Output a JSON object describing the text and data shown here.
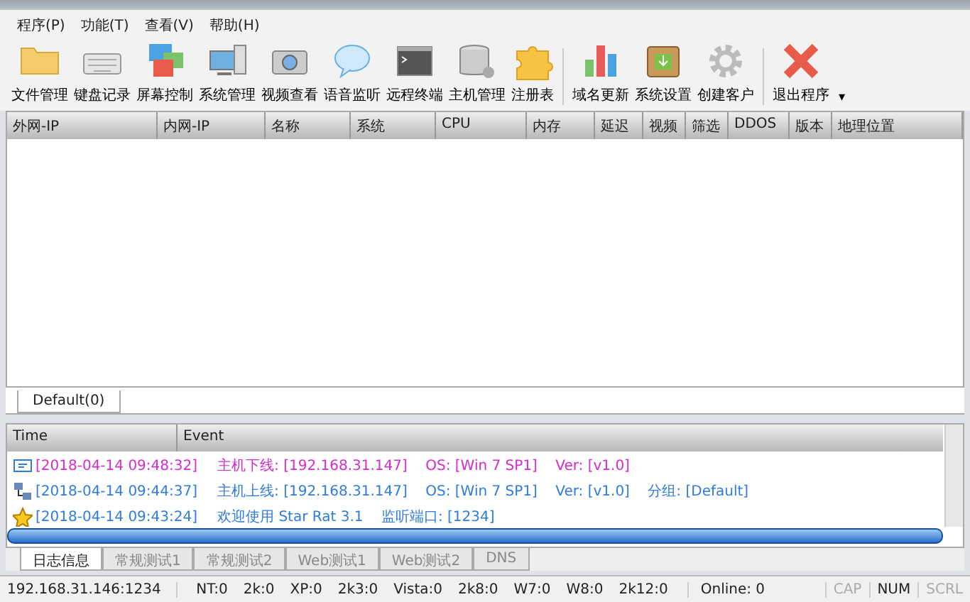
{
  "menu": [
    "程序(P)",
    "功能(T)",
    "查看(V)",
    "帮助(H)"
  ],
  "toolbar": [
    [
      {
        "label": "文件管理"
      },
      {
        "label": "键盘记录"
      },
      {
        "label": "屏幕控制"
      },
      {
        "label": "系统管理"
      },
      {
        "label": "视频查看"
      },
      {
        "label": "语音监听"
      },
      {
        "label": "远程终端"
      },
      {
        "label": "主机管理"
      },
      {
        "label": "注册表"
      }
    ],
    [
      {
        "label": "域名更新"
      },
      {
        "label": "系统设置"
      },
      {
        "label": "创建客户"
      }
    ],
    [
      {
        "label": "退出程序",
        "dropdown": "▾"
      }
    ]
  ],
  "host_table": {
    "columns": [
      "外网-IP",
      "内网-IP",
      "名称",
      "系统",
      "CPU",
      "内存",
      "延迟",
      "视频",
      "筛选",
      "DDOS",
      "版本",
      "地理位置"
    ]
  },
  "group_tabs": [
    {
      "label": "Default(0)",
      "selected": true
    }
  ],
  "log": {
    "columns": [
      "Time",
      "Event"
    ],
    "rows": [
      {
        "time": "[2018-04-14 09:48:32]",
        "event": "主机下线: [192.168.31.147]    OS: [Win 7 SP1]    Ver: [v1.0]",
        "color": "#d62ad0"
      },
      {
        "time": "[2018-04-14 09:44:37]",
        "event": "主机上线: [192.168.31.147]    OS: [Win 7 SP1]    Ver: [v1.0]    分组: [Default]",
        "color": "#2f7ce0"
      },
      {
        "time": "[2018-04-14 09:43:24]",
        "event": "欢迎使用 Star Rat 3.1    监听端口: [1234]",
        "color": "#2f7ce0"
      }
    ]
  },
  "log_tabs": [
    {
      "label": "日志信息",
      "selected": true
    },
    {
      "label": "常规测试1",
      "selected": false
    },
    {
      "label": "常规测试2",
      "selected": false
    },
    {
      "label": "Web测试1",
      "selected": false
    },
    {
      "label": "Web测试2",
      "selected": false
    },
    {
      "label": "DNS",
      "selected": false
    }
  ],
  "status_bar": {
    "address": "192.168.31.146:1234",
    "counts": [
      "NT:0",
      "2k:0",
      "XP:0",
      "2k3:0",
      "Vista:0",
      "2k8:0",
      "W7:0",
      "W8:0",
      "2k12:0"
    ],
    "online": "Online: 0",
    "keys": [
      {
        "label": "CAP",
        "on": false
      },
      {
        "label": "NUM",
        "on": true
      },
      {
        "label": "SCRL",
        "on": false
      }
    ]
  }
}
